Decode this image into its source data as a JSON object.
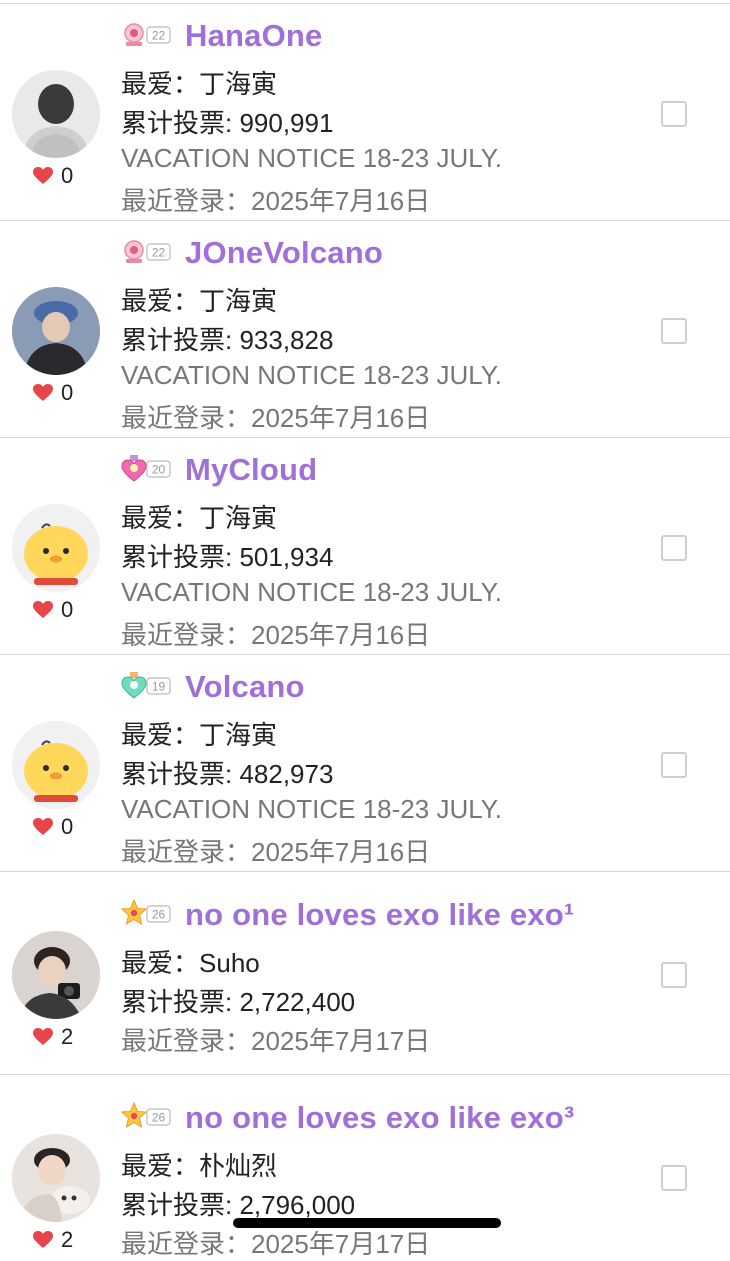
{
  "labels": {
    "favorite_prefix": "最爱：",
    "votes_prefix": "累计投票: ",
    "login_prefix": "最近登录："
  },
  "users": [
    {
      "name": "HanaOne",
      "level": "22",
      "badge_icon": "pink-trophy-badge-icon",
      "likes": "0",
      "favorite": "丁海寅",
      "votes": "990,991",
      "notice": "VACATION NOTICE 18-23 JULY.",
      "last_login": "2025年7月16日"
    },
    {
      "name": "JOneVolcano",
      "level": "22",
      "badge_icon": "pink-trophy-badge-icon",
      "likes": "0",
      "favorite": "丁海寅",
      "votes": "933,828",
      "notice": "VACATION NOTICE 18-23 JULY.",
      "last_login": "2025年7月16日"
    },
    {
      "name": "MyCloud",
      "level": "20",
      "badge_icon": "heart-medal-badge-icon",
      "likes": "0",
      "favorite": "丁海寅",
      "votes": "501,934",
      "notice": "VACATION NOTICE 18-23 JULY.",
      "last_login": "2025年7月16日"
    },
    {
      "name": "Volcano",
      "level": "19",
      "badge_icon": "green-heart-medal-badge-icon",
      "likes": "0",
      "favorite": "丁海寅",
      "votes": "482,973",
      "notice": "VACATION NOTICE 18-23 JULY.",
      "last_login": "2025年7月16日"
    },
    {
      "name": "no one loves exo like exo¹",
      "level": "26",
      "badge_icon": "star-badge-icon",
      "likes": "2",
      "favorite": "Suho",
      "votes": "2,722,400",
      "last_login": "2025年7月17日"
    },
    {
      "name": "no one loves exo like exo³",
      "level": "26",
      "badge_icon": "star-badge-icon",
      "likes": "2",
      "favorite": "朴灿烈",
      "votes": "2,796,000",
      "last_login": "2025年7月17日"
    }
  ],
  "colors": {
    "name": "#a070d8",
    "heart": "#e8454a",
    "text": "#222222",
    "secondary_text": "#777777",
    "divider": "#d6d6d6"
  }
}
